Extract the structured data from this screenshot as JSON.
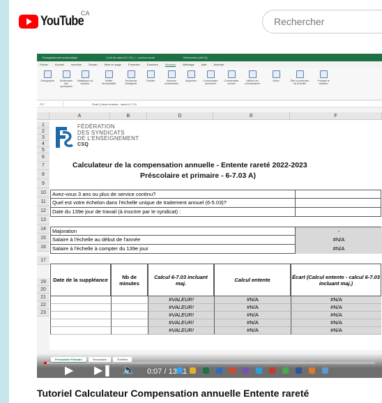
{
  "youtube": {
    "logo_text": "YouTube",
    "country": "CA",
    "search_placeholder": "Rechercher"
  },
  "excel": {
    "title_left": "Enregistrement automatique",
    "title_file": "Outil de calcul 6-7.03_1 - Lecture seule",
    "title_search": "Rechercher (Alt+Q)",
    "tabs": [
      "Fichier",
      "Accueil",
      "Insertion",
      "Dessin",
      "Mise en page",
      "Formules",
      "Données",
      "Révision",
      "Affichage",
      "Aide",
      "Antidote"
    ],
    "active_tab": "Révision",
    "ribbon": [
      "Orthographe",
      "Dictionnaire des synonymes",
      "Statistiques du classeur",
      "Vérifier l'accessibilité",
      "Recherche intelligente",
      "Traduire",
      "Nouveau commentaire",
      "Supprimer",
      "Commentaire précédent",
      "Commentaire suivant",
      "Afficher les commentaires",
      "Notes",
      "Ôter la protection de la feuille",
      "Protéger le classeur"
    ],
    "cell_ref": "F17",
    "formula": "Écart (Calcul entente - calcul 6-7.03",
    "columns": [
      "A",
      "B",
      "D",
      "E",
      "F"
    ],
    "rows": [
      "1",
      "2",
      "3",
      "4",
      "5",
      "6",
      "7",
      "8",
      "9",
      "10",
      "11",
      "12",
      "13",
      "14",
      "15",
      "16",
      "17",
      "19",
      "20",
      "21",
      "22",
      "23"
    ],
    "logo": {
      "lines": [
        "FÉDÉRATION",
        "DES SYNDICATS",
        "DE L'ENSEIGNEMENT"
      ],
      "csq": "CSQ"
    },
    "title_line1": "Calculateur de la compensation annuelle - Entente rareté 2022-2023",
    "title_line2": "Préscolaire et primaire - 6-7.03 A)",
    "questions": [
      {
        "label": "Avez-vous 3 ans ou plus de service continu?",
        "value": ""
      },
      {
        "label": "Quel est votre échelon dans l'échelle unique de traitement annuel (6-5.03)?",
        "value": ""
      },
      {
        "label": "Date du 139e jour de travail (à inscrire par le syndicat) :",
        "value": ""
      }
    ],
    "majoration": {
      "label": "Majoration",
      "value": "-"
    },
    "salaire_debut": {
      "label": "Salaire à l'échelle au début de l'année",
      "value": "#N/A"
    },
    "salaire_139": {
      "label": "Salaire à l'échelle à compter du 139e jour",
      "value": "#N/A"
    },
    "table_headers": [
      "Date de la suppléance",
      "Nb de minutes",
      "Calcul 6-7.03 incluant maj.",
      "Calcul entente",
      "Écart (Calcul entente - calcul 6-7.03 incluant maj.)"
    ],
    "table_rows": [
      [
        "",
        "",
        "#VALEUR!",
        "#N/A",
        "#N/A"
      ],
      [
        "",
        "",
        "#VALEUR!",
        "#N/A",
        "#N/A"
      ],
      [
        "",
        "",
        "#VALEUR!",
        "#N/A",
        "#N/A"
      ],
      [
        "",
        "",
        "#VALEUR!",
        "#N/A",
        "#N/A"
      ],
      [
        "",
        "",
        "#VALEUR!",
        "#N/A",
        "#N/A"
      ]
    ],
    "sheet_tabs": [
      "Préscolaire Primaire",
      "Secondaire",
      "Échelles"
    ]
  },
  "player": {
    "time": "0:07 / 13:11",
    "progress": 0.009
  },
  "video_title": "Tutoriel Calculateur Compensation annuelle Entente rareté"
}
